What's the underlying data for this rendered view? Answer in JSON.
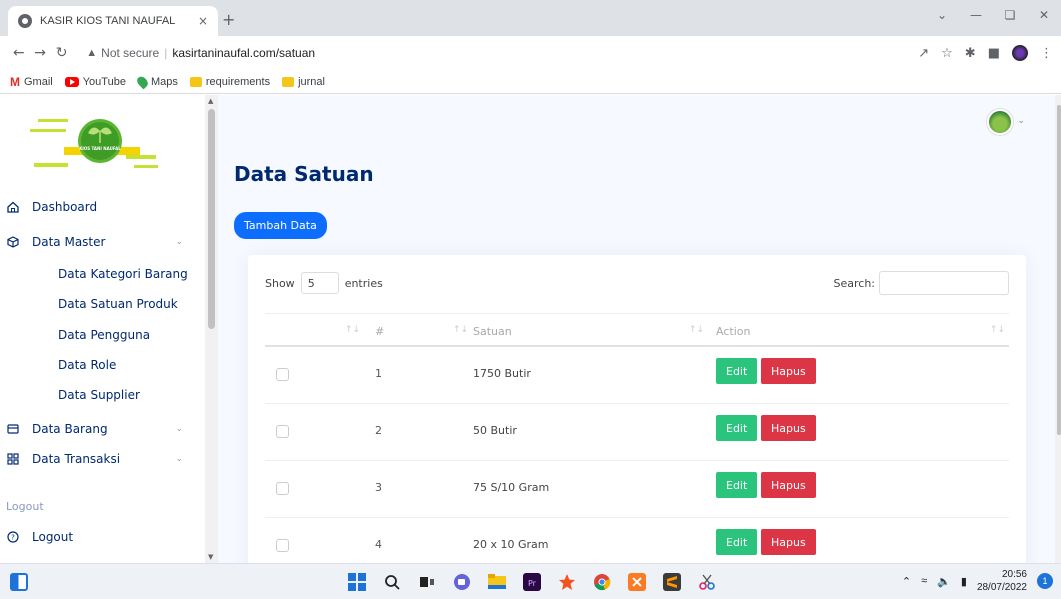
{
  "browser": {
    "tab_title": "KASIR KIOS TANI NAUFAL",
    "tab_close": "×",
    "new_tab": "+",
    "security_label": "Not secure",
    "url": "kasirtaninaufal.com/satuan",
    "bookmarks": [
      {
        "label": "Gmail",
        "icon": "gmail-icon"
      },
      {
        "label": "YouTube",
        "icon": "youtube-icon"
      },
      {
        "label": "Maps",
        "icon": "maps-icon"
      },
      {
        "label": "requirements",
        "icon": "folder-icon"
      },
      {
        "label": "jurnal",
        "icon": "folder-icon"
      }
    ]
  },
  "logo": {
    "text": "KIOS TANI NAUFAL"
  },
  "sidebar": {
    "items": [
      {
        "label": "Dashboard",
        "icon": "home-icon"
      },
      {
        "label": "Data Master",
        "icon": "box-icon"
      },
      {
        "label": "Data Barang",
        "icon": "card-icon"
      },
      {
        "label": "Data Transaksi",
        "icon": "grid-icon"
      }
    ],
    "master_sub": [
      "Data Kategori Barang",
      "Data Satuan Produk",
      "Data Pengguna",
      "Data Role",
      "Data Supplier"
    ],
    "heading_logout": "Logout",
    "logout": {
      "label": "Logout",
      "icon": "question-circle-icon"
    }
  },
  "page": {
    "title": "Data Satuan",
    "add_button": "Tambah Data"
  },
  "table": {
    "show_label": "Show",
    "entries_value": "5",
    "entries_label": "entries",
    "search_label": "Search:",
    "columns": [
      "#",
      "Satuan",
      "Action"
    ],
    "edit_label": "Edit",
    "delete_label": "Hapus",
    "rows": [
      {
        "no": "1",
        "satuan": "1750 Butir"
      },
      {
        "no": "2",
        "satuan": "50 Butir"
      },
      {
        "no": "3",
        "satuan": "75 S/10 Gram"
      },
      {
        "no": "4",
        "satuan": "20 x 10 Gram"
      }
    ]
  },
  "taskbar": {
    "time": "20:56",
    "date": "28/07/2022",
    "notifications": "1"
  },
  "colors": {
    "primary": "#0d6efd",
    "edit": "#2bc47c",
    "delete": "#dc3545",
    "nav_text": "#012970"
  }
}
